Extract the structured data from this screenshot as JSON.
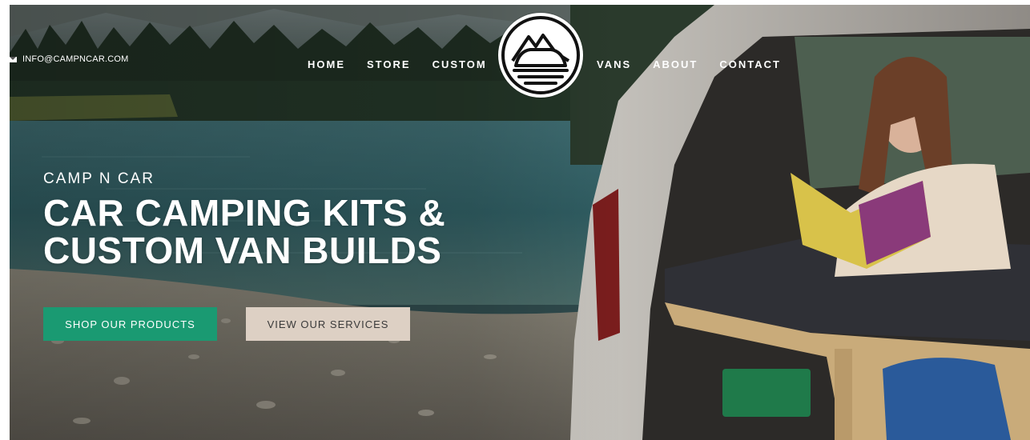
{
  "header": {
    "email": "INFO@CAMPNCAR.COM",
    "email_icon": "envelope-icon",
    "nav_left": [
      {
        "label": "HOME"
      },
      {
        "label": "STORE"
      },
      {
        "label": "CUSTOM"
      }
    ],
    "nav_right": [
      {
        "label": "VANS"
      },
      {
        "label": "ABOUT"
      },
      {
        "label": "CONTACT"
      }
    ],
    "logo_icon": "mountain-van-logo-icon"
  },
  "hero": {
    "eyebrow": "CAMP N CAR",
    "headline_line1": "CAR CAMPING KITS &",
    "headline_line2": "CUSTOM VAN BUILDS",
    "primary_button": "SHOP OUR PRODUCTS",
    "secondary_button": "VIEW OUR SERVICES",
    "colors": {
      "primary": "#1a9a72",
      "secondary": "#ddd0c4",
      "text": "#ffffff"
    }
  }
}
